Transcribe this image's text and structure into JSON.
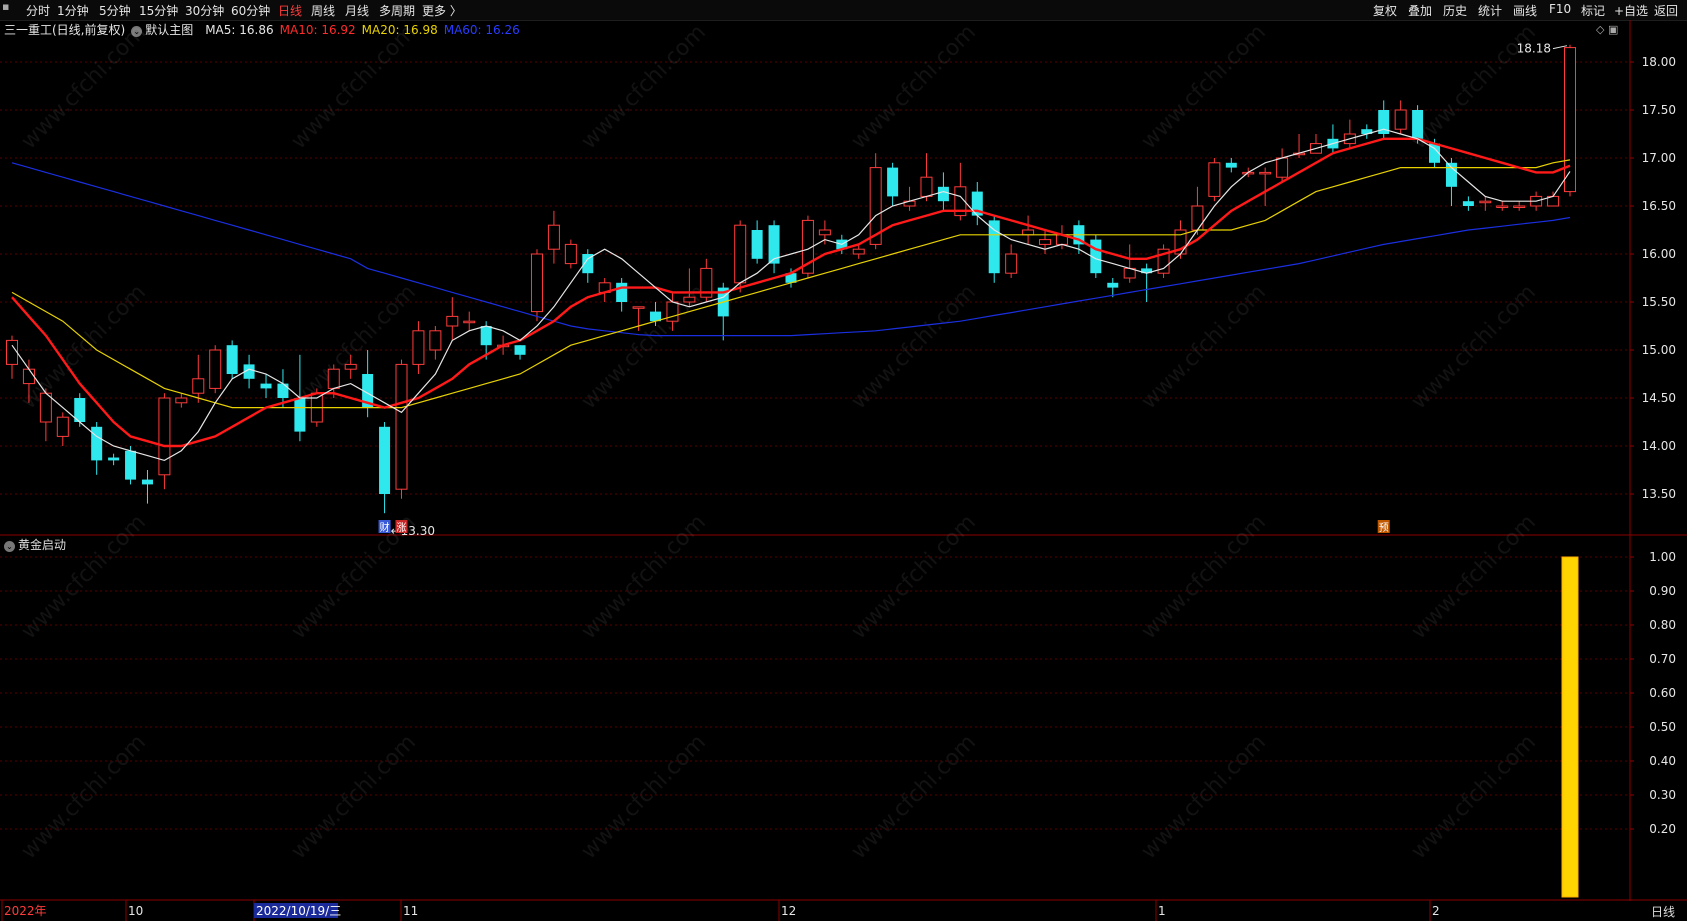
{
  "toolbar": {
    "left_items": [
      "分时",
      "1分钟",
      "5分钟",
      "15分钟",
      "30分钟",
      "60分钟",
      "日线",
      "周线",
      "月线",
      "多周期",
      "更多 〉"
    ],
    "active": "日线",
    "right_items": [
      "复权",
      "叠加",
      "历史",
      "统计",
      "画线",
      "F10",
      "标记",
      "+自选",
      "返回"
    ]
  },
  "info": {
    "stock": "三一重工(日线,前复权)",
    "main_chart": "默认主图",
    "ma5": "MA5: 16.86",
    "ma10": "MA10: 16.92",
    "ma20": "MA20: 16.98",
    "ma60": "MA60: 16.26"
  },
  "colors": {
    "up": "#ff3b3b",
    "down": "#2fe8ee",
    "ma5": "#e6e6e6",
    "ma10": "#ff1a1a",
    "ma20": "#e8d200",
    "ma60": "#1a2fe0",
    "grid": "#5a0000",
    "axis_border": "#8b0000",
    "bar": "#ffd400"
  },
  "marks": {
    "high": "18.18",
    "low": "13.30",
    "low_tags": [
      "财",
      "涨"
    ],
    "pred_tag": "预"
  },
  "subpanel": {
    "title": "黄金启动",
    "ticks": [
      "1.00",
      "0.90",
      "0.80",
      "0.70",
      "0.60",
      "0.50",
      "0.40",
      "0.30",
      "0.20"
    ],
    "signal_value": 1.0
  },
  "xaxis": {
    "labels": [
      "2022年",
      "10",
      "2022/10/19/三",
      "11",
      "12",
      "1",
      "2"
    ],
    "period": "日线"
  },
  "price_ticks": [
    "18.00",
    "17.50",
    "17.00",
    "16.50",
    "16.00",
    "15.50",
    "15.00",
    "14.50",
    "14.00",
    "13.50"
  ],
  "watermark": "www.cfchi.com",
  "chart_data": {
    "type": "candlestick",
    "ylim": [
      13.1,
      18.3
    ],
    "candles": [
      [
        14.85,
        15.1,
        15.15,
        14.7
      ],
      [
        14.65,
        14.8,
        14.9,
        14.45
      ],
      [
        14.25,
        14.55,
        14.6,
        14.05
      ],
      [
        14.1,
        14.3,
        14.35,
        14.0
      ],
      [
        14.5,
        14.25,
        14.55,
        14.2
      ],
      [
        14.2,
        13.85,
        14.25,
        13.7
      ],
      [
        13.88,
        13.85,
        13.92,
        13.8
      ],
      [
        13.95,
        13.65,
        14.0,
        13.6
      ],
      [
        13.65,
        13.6,
        13.75,
        13.4
      ],
      [
        13.7,
        14.5,
        14.55,
        13.55
      ],
      [
        14.45,
        14.5,
        14.55,
        14.4
      ],
      [
        14.55,
        14.7,
        14.95,
        14.45
      ],
      [
        14.6,
        15.0,
        15.05,
        14.55
      ],
      [
        15.05,
        14.75,
        15.1,
        14.7
      ],
      [
        14.85,
        14.7,
        14.95,
        14.6
      ],
      [
        14.65,
        14.6,
        14.75,
        14.5
      ],
      [
        14.65,
        14.5,
        14.8,
        14.4
      ],
      [
        14.5,
        14.15,
        14.95,
        14.05
      ],
      [
        14.25,
        14.55,
        14.6,
        14.2
      ],
      [
        14.6,
        14.8,
        14.85,
        14.5
      ],
      [
        14.8,
        14.85,
        14.95,
        14.7
      ],
      [
        14.75,
        14.4,
        15.0,
        14.3
      ],
      [
        14.2,
        13.5,
        14.25,
        13.3
      ],
      [
        13.55,
        14.85,
        14.9,
        13.45
      ],
      [
        14.85,
        15.2,
        15.3,
        14.75
      ],
      [
        15.0,
        15.2,
        15.25,
        14.9
      ],
      [
        15.25,
        15.35,
        15.55,
        15.1
      ],
      [
        15.3,
        15.3,
        15.4,
        15.2
      ],
      [
        15.25,
        15.05,
        15.3,
        14.9
      ],
      [
        15.05,
        15.05,
        15.15,
        14.95
      ],
      [
        15.05,
        14.95,
        15.05,
        14.9
      ],
      [
        15.4,
        16.0,
        16.05,
        15.3
      ],
      [
        16.05,
        16.3,
        16.45,
        15.9
      ],
      [
        15.9,
        16.1,
        16.15,
        15.85
      ],
      [
        16.0,
        15.8,
        16.05,
        15.7
      ],
      [
        15.6,
        15.7,
        15.75,
        15.5
      ],
      [
        15.7,
        15.5,
        15.75,
        15.4
      ],
      [
        15.45,
        15.45,
        15.45,
        15.2
      ],
      [
        15.4,
        15.3,
        15.5,
        15.25
      ],
      [
        15.3,
        15.5,
        15.6,
        15.2
      ],
      [
        15.5,
        15.55,
        15.85,
        15.45
      ],
      [
        15.55,
        15.85,
        15.95,
        15.5
      ],
      [
        15.65,
        15.35,
        15.7,
        15.1
      ],
      [
        15.7,
        16.3,
        16.35,
        15.6
      ],
      [
        16.25,
        15.95,
        16.35,
        15.9
      ],
      [
        16.3,
        15.9,
        16.35,
        15.8
      ],
      [
        15.8,
        15.7,
        15.85,
        15.65
      ],
      [
        15.8,
        16.35,
        16.4,
        15.75
      ],
      [
        16.2,
        16.25,
        16.35,
        16.1
      ],
      [
        16.15,
        16.05,
        16.2,
        16.0
      ],
      [
        16.0,
        16.05,
        16.1,
        15.95
      ],
      [
        16.1,
        16.9,
        17.05,
        16.05
      ],
      [
        16.9,
        16.6,
        16.95,
        16.5
      ],
      [
        16.5,
        16.55,
        16.7,
        16.45
      ],
      [
        16.6,
        16.8,
        17.05,
        16.55
      ],
      [
        16.7,
        16.55,
        16.85,
        16.45
      ],
      [
        16.4,
        16.7,
        16.95,
        16.35
      ],
      [
        16.65,
        16.4,
        16.75,
        16.3
      ],
      [
        16.35,
        15.8,
        16.4,
        15.7
      ],
      [
        15.8,
        16.0,
        16.1,
        15.75
      ],
      [
        16.2,
        16.25,
        16.4,
        16.1
      ],
      [
        16.1,
        16.15,
        16.25,
        16.0
      ],
      [
        16.1,
        16.2,
        16.3,
        16.05
      ],
      [
        16.3,
        16.1,
        16.35,
        16.0
      ],
      [
        16.15,
        15.8,
        16.2,
        15.75
      ],
      [
        15.7,
        15.65,
        15.75,
        15.55
      ],
      [
        15.75,
        15.85,
        16.1,
        15.7
      ],
      [
        15.85,
        15.8,
        15.9,
        15.5
      ],
      [
        15.8,
        16.05,
        16.1,
        15.75
      ],
      [
        16.0,
        16.25,
        16.35,
        15.95
      ],
      [
        16.25,
        16.5,
        16.7,
        16.2
      ],
      [
        16.6,
        16.95,
        17.0,
        16.55
      ],
      [
        16.95,
        16.9,
        17.0,
        16.85
      ],
      [
        16.85,
        16.85,
        16.9,
        16.8
      ],
      [
        16.85,
        16.85,
        16.9,
        16.5
      ],
      [
        16.8,
        17.0,
        17.1,
        16.75
      ],
      [
        17.05,
        17.05,
        17.25,
        17.0
      ],
      [
        17.05,
        17.15,
        17.25,
        17.05
      ],
      [
        17.2,
        17.1,
        17.35,
        17.05
      ],
      [
        17.15,
        17.25,
        17.4,
        17.1
      ],
      [
        17.3,
        17.25,
        17.35,
        17.2
      ],
      [
        17.5,
        17.25,
        17.6,
        17.2
      ],
      [
        17.3,
        17.5,
        17.6,
        17.25
      ],
      [
        17.5,
        17.2,
        17.55,
        17.15
      ],
      [
        17.15,
        16.95,
        17.2,
        16.9
      ],
      [
        16.95,
        16.7,
        17.0,
        16.5
      ],
      [
        16.55,
        16.5,
        16.6,
        16.45
      ],
      [
        16.55,
        16.55,
        16.6,
        16.45
      ],
      [
        16.5,
        16.5,
        16.55,
        16.45
      ],
      [
        16.5,
        16.5,
        16.55,
        16.45
      ],
      [
        16.5,
        16.6,
        16.65,
        16.45
      ],
      [
        16.5,
        16.6,
        16.65,
        16.5
      ],
      [
        16.65,
        18.15,
        18.18,
        16.6
      ]
    ],
    "ma5": [
      15.05,
      14.8,
      14.55,
      14.4,
      14.25,
      14.1,
      14.0,
      13.95,
      13.9,
      13.85,
      13.95,
      14.15,
      14.45,
      14.7,
      14.8,
      14.75,
      14.65,
      14.5,
      14.5,
      14.6,
      14.65,
      14.55,
      14.45,
      14.35,
      14.55,
      14.75,
      15.1,
      15.2,
      15.25,
      15.2,
      15.1,
      15.25,
      15.45,
      15.7,
      15.95,
      16.05,
      15.95,
      15.8,
      15.65,
      15.5,
      15.45,
      15.5,
      15.55,
      15.7,
      15.8,
      15.95,
      16.0,
      16.05,
      16.15,
      16.1,
      16.2,
      16.4,
      16.5,
      16.55,
      16.6,
      16.65,
      16.6,
      16.4,
      16.25,
      16.15,
      16.1,
      16.05,
      16.1,
      16.05,
      15.95,
      15.9,
      15.85,
      15.8,
      15.85,
      16.0,
      16.25,
      16.5,
      16.7,
      16.85,
      16.95,
      17.0,
      17.05,
      17.1,
      17.15,
      17.2,
      17.25,
      17.3,
      17.25,
      17.2,
      17.1,
      16.9,
      16.75,
      16.6,
      16.55,
      16.55,
      16.55,
      16.6,
      16.86
    ],
    "ma10": [
      15.55,
      15.35,
      15.15,
      14.9,
      14.65,
      14.45,
      14.25,
      14.1,
      14.05,
      14.0,
      14.0,
      14.05,
      14.1,
      14.2,
      14.3,
      14.4,
      14.45,
      14.5,
      14.55,
      14.55,
      14.5,
      14.45,
      14.4,
      14.45,
      14.5,
      14.6,
      14.7,
      14.85,
      14.95,
      15.05,
      15.1,
      15.2,
      15.3,
      15.45,
      15.55,
      15.6,
      15.65,
      15.65,
      15.65,
      15.6,
      15.6,
      15.6,
      15.6,
      15.65,
      15.7,
      15.75,
      15.8,
      15.9,
      16.0,
      16.05,
      16.1,
      16.2,
      16.3,
      16.35,
      16.4,
      16.45,
      16.45,
      16.45,
      16.4,
      16.35,
      16.3,
      16.25,
      16.2,
      16.15,
      16.05,
      16.0,
      15.95,
      15.95,
      16.0,
      16.05,
      16.15,
      16.3,
      16.45,
      16.55,
      16.65,
      16.75,
      16.85,
      16.95,
      17.05,
      17.1,
      17.15,
      17.2,
      17.2,
      17.2,
      17.15,
      17.1,
      17.05,
      17.0,
      16.95,
      16.9,
      16.85,
      16.85,
      16.92
    ],
    "ma20": [
      15.6,
      15.5,
      15.4,
      15.3,
      15.15,
      15.0,
      14.9,
      14.8,
      14.7,
      14.6,
      14.55,
      14.5,
      14.45,
      14.4,
      14.4,
      14.4,
      14.4,
      14.4,
      14.4,
      14.4,
      14.4,
      14.4,
      14.4,
      14.4,
      14.45,
      14.5,
      14.55,
      14.6,
      14.65,
      14.7,
      14.75,
      14.85,
      14.95,
      15.05,
      15.1,
      15.15,
      15.2,
      15.25,
      15.3,
      15.35,
      15.4,
      15.45,
      15.5,
      15.55,
      15.6,
      15.65,
      15.7,
      15.75,
      15.8,
      15.85,
      15.9,
      15.95,
      16.0,
      16.05,
      16.1,
      16.15,
      16.2,
      16.2,
      16.2,
      16.2,
      16.2,
      16.2,
      16.2,
      16.2,
      16.2,
      16.2,
      16.2,
      16.2,
      16.2,
      16.2,
      16.25,
      16.25,
      16.25,
      16.3,
      16.35,
      16.45,
      16.55,
      16.65,
      16.7,
      16.75,
      16.8,
      16.85,
      16.9,
      16.9,
      16.9,
      16.9,
      16.9,
      16.9,
      16.9,
      16.9,
      16.9,
      16.95,
      16.98
    ],
    "ma60": [
      16.95,
      16.9,
      16.85,
      16.8,
      16.75,
      16.7,
      16.65,
      16.6,
      16.55,
      16.5,
      16.45,
      16.4,
      16.35,
      16.3,
      16.25,
      16.2,
      16.15,
      16.1,
      16.05,
      16.0,
      15.95,
      15.85,
      15.8,
      15.75,
      15.7,
      15.65,
      15.6,
      15.55,
      15.5,
      15.45,
      15.4,
      15.35,
      15.3,
      15.25,
      15.22,
      15.2,
      15.18,
      15.16,
      15.15,
      15.15,
      15.15,
      15.15,
      15.15,
      15.15,
      15.15,
      15.15,
      15.15,
      15.16,
      15.17,
      15.18,
      15.19,
      15.2,
      15.22,
      15.24,
      15.26,
      15.28,
      15.3,
      15.33,
      15.36,
      15.39,
      15.42,
      15.45,
      15.48,
      15.51,
      15.54,
      15.57,
      15.6,
      15.63,
      15.66,
      15.69,
      15.72,
      15.75,
      15.78,
      15.81,
      15.84,
      15.87,
      15.9,
      15.94,
      15.98,
      16.02,
      16.06,
      16.1,
      16.13,
      16.16,
      16.19,
      16.22,
      16.25,
      16.27,
      16.29,
      16.31,
      16.33,
      16.35,
      16.38
    ]
  }
}
